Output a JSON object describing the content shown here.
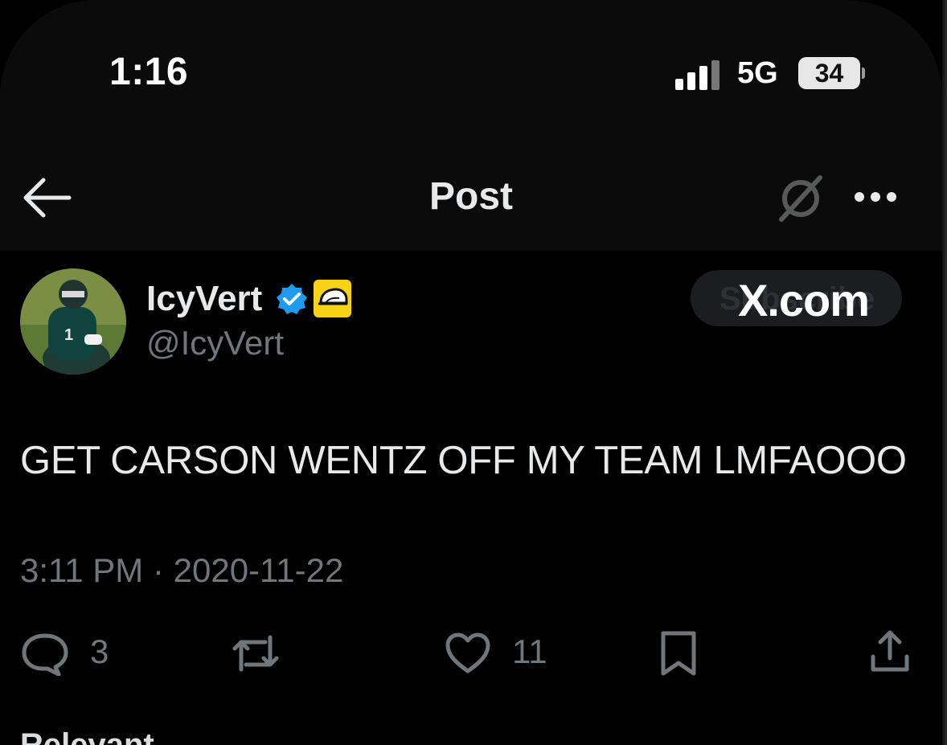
{
  "status_bar": {
    "time": "1:16",
    "network": "5G",
    "battery": "34"
  },
  "header": {
    "title": "Post",
    "back_icon": "arrow-left-icon",
    "grok_icon": "grok-icon",
    "more_icon": "more-horizontal-icon"
  },
  "post": {
    "author_name": "IcyVert",
    "author_handle": "@IcyVert",
    "subscribe_label": "Subscribe",
    "watermark": "X.com",
    "text": "GET CARSON WENTZ OFF MY TEAM LMFAOOO",
    "timestamp": "3:11 PM · 2020-11-22"
  },
  "actions": {
    "replies": "3",
    "reposts": "",
    "likes": "11"
  },
  "footer": {
    "sort_label": "Relevant"
  },
  "colors": {
    "background": "#000000",
    "text": "#e7e9ea",
    "secondary": "#71767b",
    "verified": "#1d9bf0",
    "badge": "#f7d317"
  }
}
